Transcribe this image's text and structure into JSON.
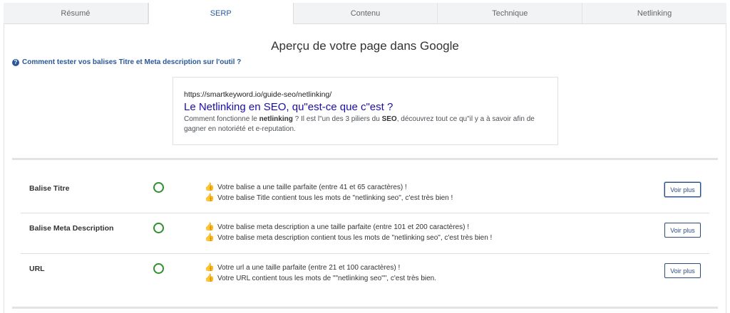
{
  "tabs": [
    {
      "label": "Résumé"
    },
    {
      "label": "SERP"
    },
    {
      "label": "Contenu"
    },
    {
      "label": "Technique"
    },
    {
      "label": "Netlinking"
    }
  ],
  "page_title": "Aperçu de votre page dans Google",
  "help_link": "Comment tester vos balises Titre et Meta description sur l'outil ?",
  "preview": {
    "url": "https://smartkeyword.io/guide-seo/netlinking/",
    "title": "Le Netlinking en SEO, qu\"est-ce que c\"est ?",
    "desc_1": "Comment fonctionne le ",
    "desc_b1": "netlinking",
    "desc_2": " ? Il est l\"un des 3 piliers du ",
    "desc_b2": "SEO",
    "desc_3": ", découvrez tout ce qu\"il y a à savoir afin de gagner en notoriété et e-reputation."
  },
  "rows": [
    {
      "label": "Balise Titre",
      "messages": [
        "Votre balise a une taille parfaite (entre 41 et 65 caractères) !",
        "Votre balise Title contient tous les mots de \"netlinking seo\", c'est très bien !"
      ],
      "button": "Voir plus"
    },
    {
      "label": "Balise Meta Description",
      "messages": [
        "Votre balise meta description a une taille parfaite (entre 101 et 200 caractères) !",
        "Votre balise meta description contient tous les mots de \"netlinking seo\", c'est très bien !"
      ],
      "button": "Voir plus"
    },
    {
      "label": "URL",
      "messages": [
        "Votre url a une taille parfaite (entre 21 et 100 caractères) !",
        "Votre URL contient tous les mots de \"\"netlinking seo\"\", c'est très bien."
      ],
      "button": "Voir plus"
    }
  ],
  "icons": {
    "help": "question-circle-icon",
    "status_ok": "green-circle-icon",
    "thumb": "thumbs-up-icon"
  },
  "colors": {
    "link_blue": "#1a0dab",
    "accent": "#2b5797",
    "status_green": "#2f8f2f",
    "thumb_yellow": "#f2b84b"
  }
}
